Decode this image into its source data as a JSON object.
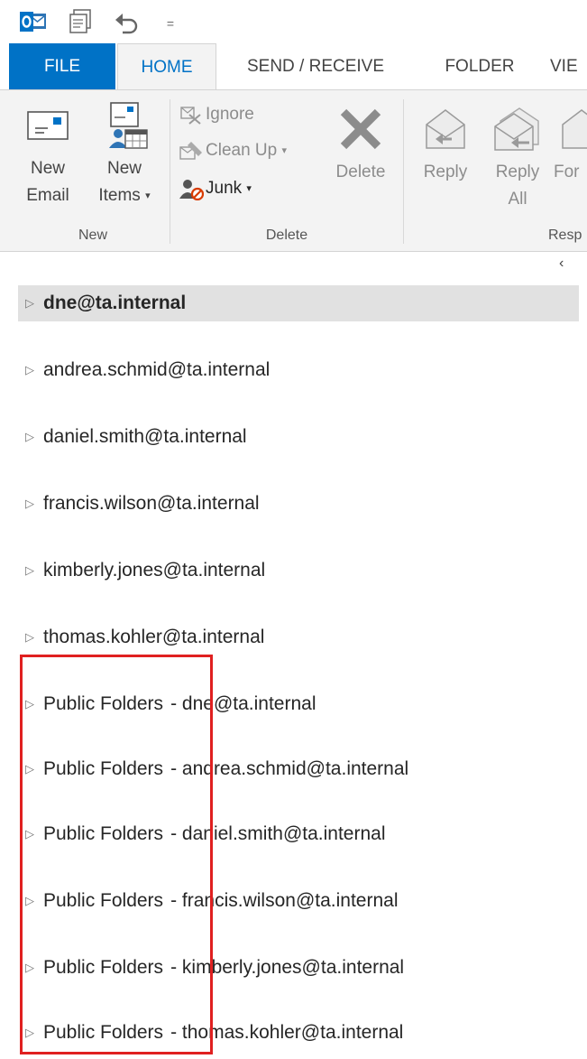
{
  "quick_access": {
    "icons": [
      "outlook-logo-icon",
      "send-receive-all-icon",
      "undo-icon",
      "customize-qat-icon"
    ],
    "customize_glyph": "="
  },
  "tabs": [
    {
      "label": "FILE"
    },
    {
      "label": "HOME",
      "active": true
    },
    {
      "label": "SEND / RECEIVE"
    },
    {
      "label": "FOLDER"
    },
    {
      "label": "VIE"
    }
  ],
  "ribbon": {
    "new_group": {
      "new_email_line1": "New",
      "new_email_line2": "Email",
      "new_items_line1": "New",
      "new_items_line2": "Items",
      "label": "New"
    },
    "delete_group": {
      "ignore": "Ignore",
      "clean_up": "Clean Up",
      "junk": "Junk",
      "delete": "Delete",
      "label": "Delete"
    },
    "respond_group": {
      "reply": "Reply",
      "reply_all_line1": "Reply",
      "reply_all_line2": "All",
      "forward_partial": "For",
      "label": "Resp"
    },
    "collapse_glyph": "‹"
  },
  "folder_pane": {
    "expand_glyph": "▷",
    "accounts": [
      {
        "name": "dne@ta.internal",
        "selected": true
      },
      {
        "name": "andrea.schmid@ta.internal"
      },
      {
        "name": "daniel.smith@ta.internal"
      },
      {
        "name": "francis.wilson@ta.internal"
      },
      {
        "name": "kimberly.jones@ta.internal"
      },
      {
        "name": "thomas.kohler@ta.internal"
      }
    ],
    "public_folders": [
      {
        "prefix": "Public Folders",
        "separator": "-",
        "name": "dne@ta.internal"
      },
      {
        "prefix": "Public Folders",
        "separator": "-",
        "name": "andrea.schmid@ta.internal"
      },
      {
        "prefix": "Public Folders",
        "separator": "-",
        "name": "daniel.smith@ta.internal"
      },
      {
        "prefix": "Public Folders",
        "separator": "-",
        "name": "francis.wilson@ta.internal"
      },
      {
        "prefix": "Public Folders",
        "separator": "-",
        "name": "kimberly.jones@ta.internal"
      },
      {
        "prefix": "Public Folders",
        "separator": "-",
        "name": "thomas.kohler@ta.internal"
      }
    ]
  },
  "colors": {
    "accent": "#0072c6",
    "ribbon_bg": "#f3f3f3",
    "selected_row": "#e1e1e1",
    "highlight_box": "#e02020"
  }
}
